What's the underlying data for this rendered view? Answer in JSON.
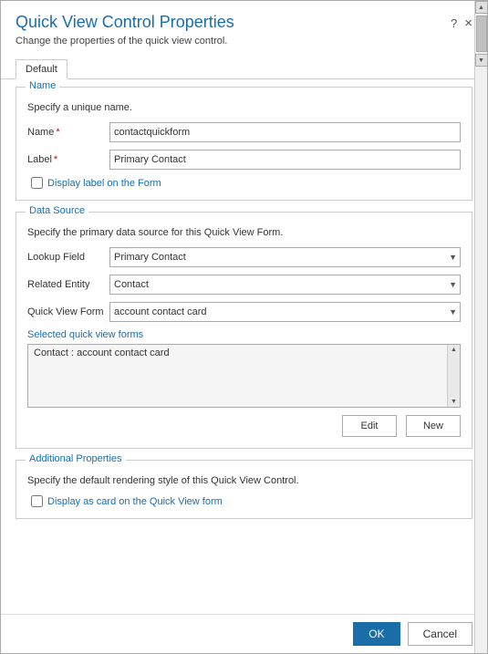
{
  "dialog": {
    "title": "Quick View Control Properties",
    "subtitle": "Change the properties of the quick view control.",
    "help_icon": "?",
    "close_icon": "×"
  },
  "tabs": [
    {
      "label": "Default",
      "active": true
    }
  ],
  "name_section": {
    "legend": "Name",
    "description": "Specify a unique name.",
    "fields": [
      {
        "label": "Name",
        "required": true,
        "value": "contactquickform",
        "type": "text"
      },
      {
        "label": "Label",
        "required": true,
        "value": "Primary Contact",
        "type": "text"
      }
    ],
    "checkbox_label": "Display label on the Form"
  },
  "datasource_section": {
    "legend": "Data Source",
    "description": "Specify the primary data source for this Quick View Form.",
    "fields": [
      {
        "label": "Lookup Field",
        "value": "Primary Contact",
        "type": "select",
        "options": [
          "Primary Contact"
        ]
      },
      {
        "label": "Related Entity",
        "value": "Contact",
        "type": "select",
        "options": [
          "Contact"
        ]
      },
      {
        "label": "Quick View Form",
        "value": "account contact card",
        "type": "select",
        "options": [
          "account contact card"
        ]
      }
    ],
    "selected_label": "Selected quick view forms",
    "listbox_item": "Contact : account contact card",
    "edit_button": "Edit",
    "new_button": "New"
  },
  "additional_section": {
    "legend": "Additional Properties",
    "description": "Specify the default rendering style of this Quick View Control.",
    "checkbox_label": "Display as card on the Quick View form"
  },
  "footer": {
    "ok_label": "OK",
    "cancel_label": "Cancel"
  }
}
